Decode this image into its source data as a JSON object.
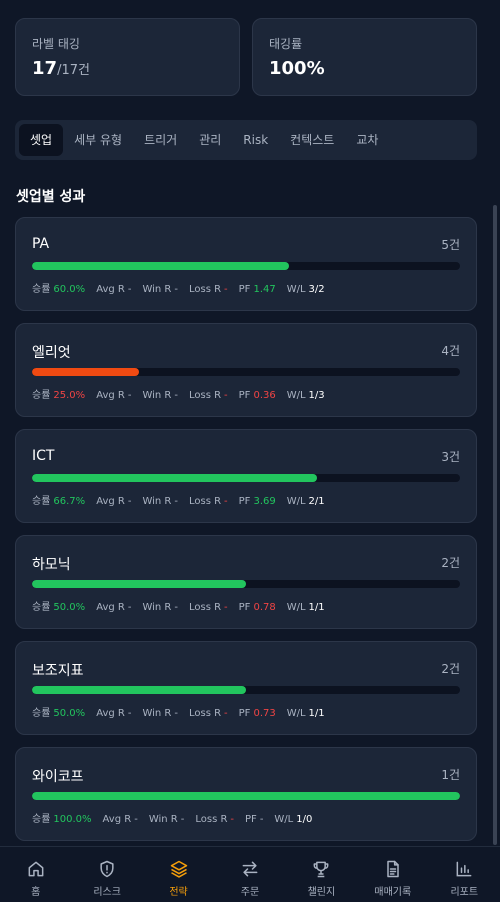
{
  "stats": {
    "labeling": {
      "label": "라벨 태깅",
      "value": "17",
      "suffix": "/17건"
    },
    "tagging_rate": {
      "label": "태깅률",
      "value": "100%"
    }
  },
  "tabs": [
    "셋업",
    "세부 유형",
    "트리거",
    "관리",
    "Risk",
    "컨텍스트",
    "교차"
  ],
  "active_tab": "셋업",
  "section_title": "셋업별 성과",
  "stat_labels": {
    "winrate": "승률",
    "avg_r": "Avg R",
    "win_r": "Win R",
    "loss_r": "Loss R",
    "pf": "PF",
    "wl": "W/L"
  },
  "setups": [
    {
      "name": "PA",
      "count": "5건",
      "winrate": "60.0%",
      "avg_r": "-",
      "win_r": "-",
      "loss_r": "-",
      "pf": "1.47",
      "wl": "3/2",
      "progress": 0.6,
      "bar_color": "#22c55e",
      "winrate_color": "#22c55e",
      "pf_color": "#22c55e"
    },
    {
      "name": "엘리엇",
      "count": "4건",
      "winrate": "25.0%",
      "avg_r": "-",
      "win_r": "-",
      "loss_r": "-",
      "pf": "0.36",
      "wl": "1/3",
      "progress": 0.25,
      "bar_color": "#f04a12",
      "winrate_color": "#ef4444",
      "pf_color": "#ef4444"
    },
    {
      "name": "ICT",
      "count": "3건",
      "winrate": "66.7%",
      "avg_r": "-",
      "win_r": "-",
      "loss_r": "-",
      "pf": "3.69",
      "wl": "2/1",
      "progress": 0.667,
      "bar_color": "#22c55e",
      "winrate_color": "#22c55e",
      "pf_color": "#22c55e"
    },
    {
      "name": "하모닉",
      "count": "2건",
      "winrate": "50.0%",
      "avg_r": "-",
      "win_r": "-",
      "loss_r": "-",
      "pf": "0.78",
      "wl": "1/1",
      "progress": 0.5,
      "bar_color": "#22c55e",
      "winrate_color": "#22c55e",
      "pf_color": "#ef4444"
    },
    {
      "name": "보조지표",
      "count": "2건",
      "winrate": "50.0%",
      "avg_r": "-",
      "win_r": "-",
      "loss_r": "-",
      "pf": "0.73",
      "wl": "1/1",
      "progress": 0.5,
      "bar_color": "#22c55e",
      "winrate_color": "#22c55e",
      "pf_color": "#ef4444"
    },
    {
      "name": "와이코프",
      "count": "1건",
      "winrate": "100.0%",
      "avg_r": "-",
      "win_r": "-",
      "loss_r": "-",
      "pf": "-",
      "wl": "1/0",
      "progress": 1.0,
      "bar_color": "#22c55e",
      "winrate_color": "#22c55e",
      "pf_color": "#aab3c2"
    }
  ],
  "nav": [
    {
      "label": "홈",
      "icon": "home-icon"
    },
    {
      "label": "리스크",
      "icon": "shield-alert-icon"
    },
    {
      "label": "전략",
      "icon": "layers-icon"
    },
    {
      "label": "주문",
      "icon": "swap-arrows-icon"
    },
    {
      "label": "챌린지",
      "icon": "trophy-icon"
    },
    {
      "label": "매매기록",
      "icon": "document-icon"
    },
    {
      "label": "리포트",
      "icon": "bar-chart-icon"
    }
  ],
  "active_nav": "전략"
}
